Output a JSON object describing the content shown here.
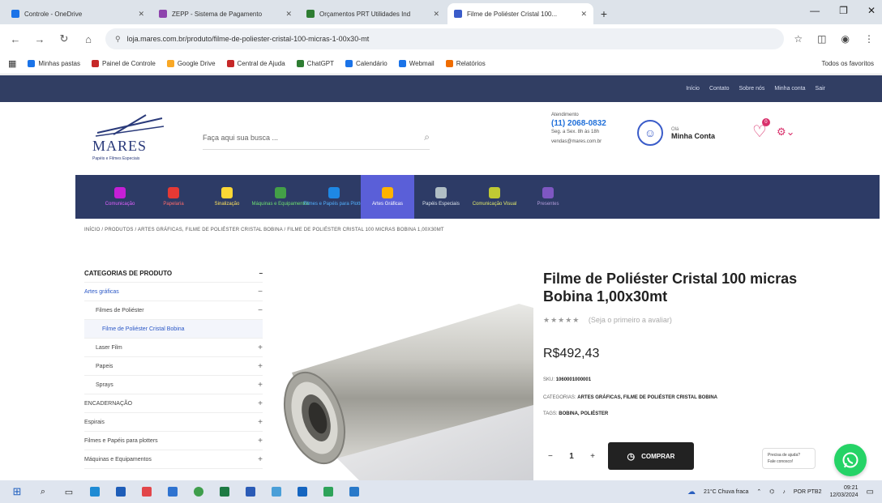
{
  "browser": {
    "tabs": [
      {
        "label": "Controle - OneDrive",
        "fav": "#1a73e8",
        "active": false
      },
      {
        "label": "ZEPP - Sistema de Pagamento",
        "fav": "#8e44ad",
        "active": false
      },
      {
        "label": "Orçamentos PRT Utilidades Ind",
        "fav": "#2e7d32",
        "active": false
      },
      {
        "label": "Filme de Poliéster Cristal 100...",
        "fav": "#3a5cc9",
        "active": true
      }
    ],
    "new_tab": "+",
    "url": "loja.mares.com.br/produto/filme-de-poliester-cristal-100-micras-1-00x30-mt",
    "bookmarks": [
      {
        "label": "Minhas pastas",
        "fav": "#1a73e8"
      },
      {
        "label": "Painel de Controle",
        "fav": "#c62828"
      },
      {
        "label": "Google Drive",
        "fav": "#f9a825"
      },
      {
        "label": "Central de Ajuda",
        "fav": "#c62828"
      },
      {
        "label": "ChatGPT",
        "fav": "#2e7d32"
      },
      {
        "label": "Calendário",
        "fav": "#1a73e8"
      },
      {
        "label": "Webmail",
        "fav": "#1a73e8"
      },
      {
        "label": "Relatórios",
        "fav": "#ef6c00"
      }
    ],
    "bookmarks_right": "Todos os favoritos"
  },
  "site": {
    "top_links": [
      "Início",
      "Contato",
      "Sobre nós",
      "Minha conta",
      "Sair"
    ],
    "search_placeholder": "Faça aqui sua busca ...",
    "phone": {
      "label": "Atendimento",
      "number": "(11) 2068-0832",
      "hours": "Seg. a Sex. 8h às 18h",
      "extra": "vendas@mares.com.br"
    },
    "account": {
      "small": "Olá",
      "label": "Minha Conta"
    },
    "wishlist_count": "0",
    "logo_text": "MARES",
    "logo_sub": "Papéis e Filmes Especiais",
    "categories": [
      {
        "label": "Comunicação",
        "color": "#c51fd6",
        "text": "#e060ff"
      },
      {
        "label": "Papelaria",
        "color": "#e53935",
        "text": "#ff6b6b"
      },
      {
        "label": "Sinalização",
        "color": "#fdd835",
        "text": "#ffe45c"
      },
      {
        "label": "Máquinas e Equipamentos",
        "color": "#43a047",
        "text": "#6ee071"
      },
      {
        "label": "Filmes e Papéis para Plotter",
        "color": "#1e88e5",
        "text": "#53b2ff"
      },
      {
        "label": "Artes Gráficas",
        "color": "#ffb300",
        "text": "#ffffff"
      },
      {
        "label": "Papéis Especiais",
        "color": "#b0bec5",
        "text": "#dfe6ee"
      },
      {
        "label": "Comunicação Visual",
        "color": "#c0ca33",
        "text": "#e2ea6b"
      },
      {
        "label": "Presentes",
        "color": "#7e57c2",
        "text": "#b39ddb"
      }
    ],
    "breadcrumb": "INÍCIO  /  PRODUTOS  /  ARTES GRÁFICAS, FILME DE POLIÉSTER CRISTAL BOBINA  /  FILME DE POLIÉSTER CRISTAL 100 MICRAS BOBINA 1,00X30MT"
  },
  "sidebar": {
    "title": "CATEGORIAS DE PRODUTO",
    "items": [
      {
        "label": "Artes gráficas",
        "level": "l1",
        "toggle": "−"
      },
      {
        "label": "Filmes de Poliéster",
        "level": "l2",
        "toggle": "−"
      },
      {
        "label": "Filme de Poliéster Cristal Bobina",
        "level": "l3",
        "toggle": ""
      },
      {
        "label": "Laser Film",
        "level": "l2",
        "toggle": "+"
      },
      {
        "label": "Papeis",
        "level": "l2",
        "toggle": "+"
      },
      {
        "label": "Sprays",
        "level": "l2",
        "toggle": "+"
      },
      {
        "label": "ENCADERNAÇÃO",
        "level": "l0",
        "toggle": "+"
      },
      {
        "label": "Espirais",
        "level": "l0",
        "toggle": "+"
      },
      {
        "label": "Filmes e Papéis para plotters",
        "level": "l0",
        "toggle": "+"
      },
      {
        "label": "Máquinas e Equipamentos",
        "level": "l0",
        "toggle": "+"
      }
    ]
  },
  "product": {
    "title": "Filme de Poliéster Cristal 100 micras Bobina 1,00x30mt",
    "stars": "★★★★★",
    "reviews": "(Seja o primeiro a avaliar)",
    "price": "R$492,43",
    "sku_label": "SKU:",
    "sku": "1060001000001",
    "categories_label": "CATEGORIAS:",
    "categories": "ARTES GRÁFICAS, FILME DE POLIÉSTER CRISTAL BOBINA",
    "tags_label": "TAGS:",
    "tags": "BOBINA, POLIÉSTER",
    "qty": "1",
    "qty_minus": "−",
    "qty_plus": "+",
    "buy_label": "COMPRAR",
    "help_line1": "Precisa de ajuda?",
    "help_line2": "Fale conosco!"
  },
  "taskbar": {
    "weather": "21°C  Chuva fraca",
    "lang": "POR PTB2",
    "time": "09:21",
    "date": "12/03/2024"
  }
}
